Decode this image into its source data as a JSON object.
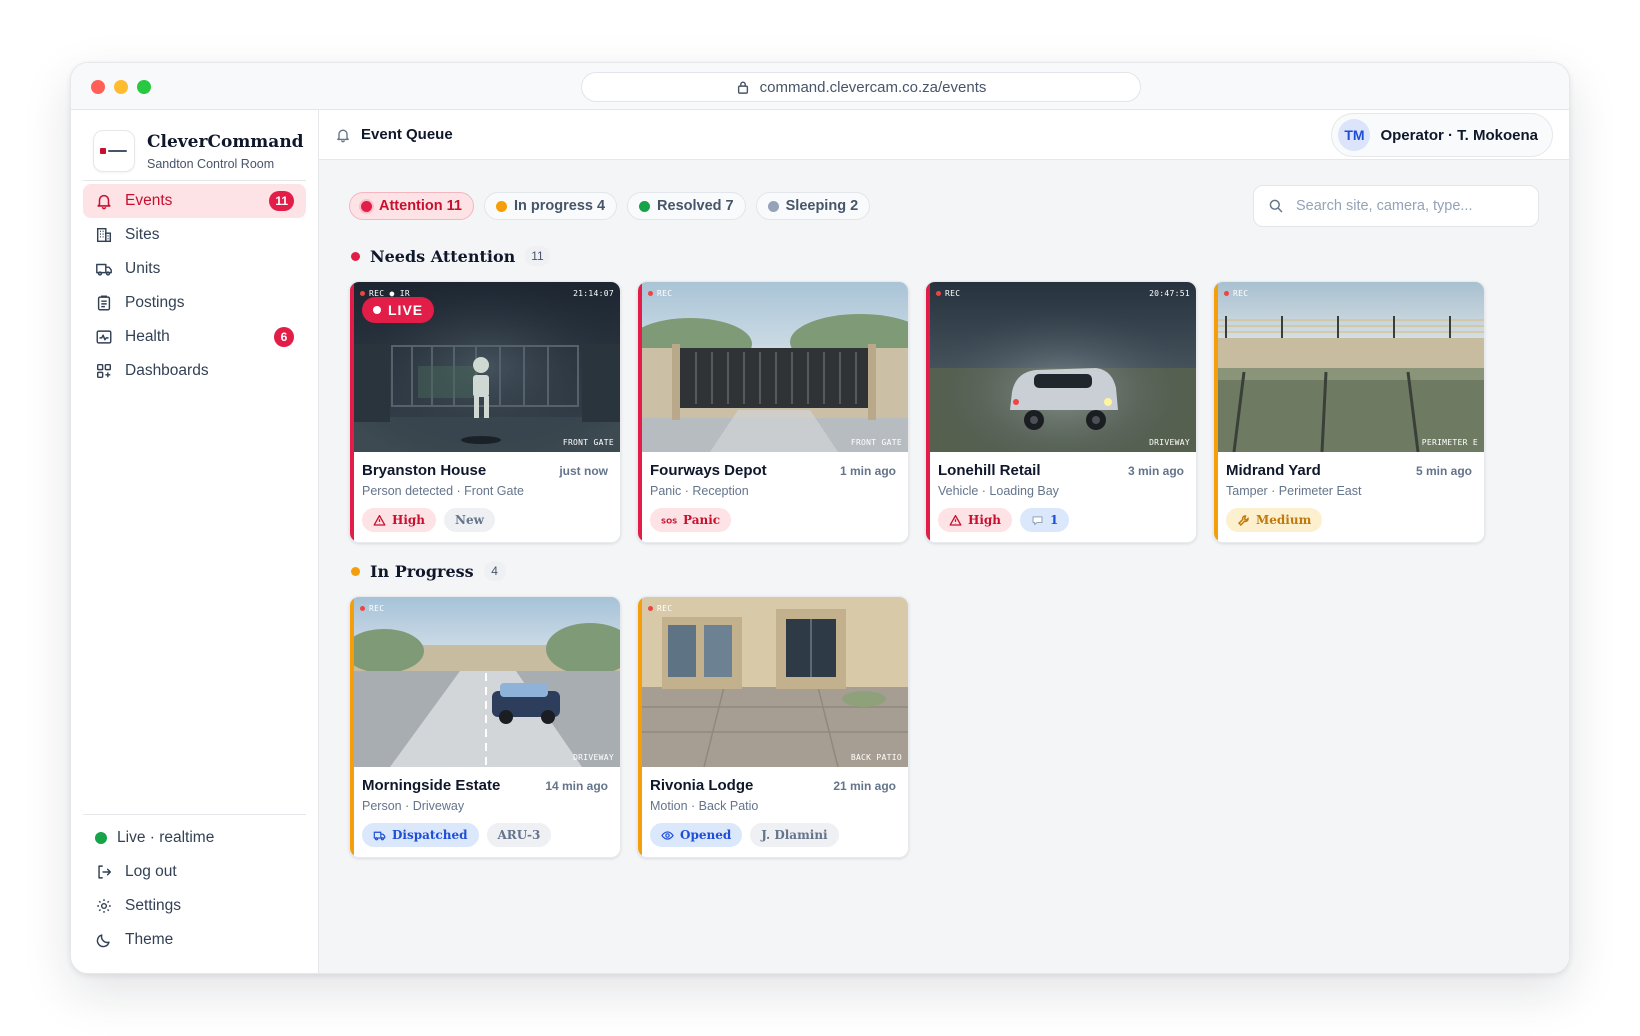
{
  "browser": {
    "url": "command.clevercam.co.za/events"
  },
  "brand": {
    "name": "CleverCommand",
    "subtitle": "Sandton Control Room"
  },
  "nav": [
    {
      "label": "Events",
      "icon": "bell-icon",
      "badge": "11",
      "active": true
    },
    {
      "label": "Sites",
      "icon": "building-icon",
      "badge": ""
    },
    {
      "label": "Units",
      "icon": "truck-icon",
      "badge": ""
    },
    {
      "label": "Postings",
      "icon": "clipboard-icon",
      "badge": ""
    },
    {
      "label": "Health",
      "icon": "activity-icon",
      "badge": "6"
    },
    {
      "label": "Dashboards",
      "icon": "grid-icon",
      "badge": ""
    }
  ],
  "sidebar_bottom": {
    "live_label": "Live · realtime",
    "logout_label": "Log out",
    "settings_label": "Settings",
    "theme_label": "Theme"
  },
  "topbar": {
    "title": "Event Queue",
    "operator_initials": "TM",
    "operator_label": "Operator · T. Mokoena"
  },
  "filters": [
    {
      "label": "Attention 11",
      "color": "#e11d48",
      "active": true
    },
    {
      "label": "In progress 4",
      "color": "#f59e0b",
      "active": false
    },
    {
      "label": "Resolved 7",
      "color": "#16a34a",
      "active": false
    },
    {
      "label": "Sleeping 2",
      "color": "#94a3b8",
      "active": false
    }
  ],
  "search": {
    "placeholder": "Search site, camera, type..."
  },
  "sections": [
    {
      "title": "Needs Attention",
      "count": "11",
      "color": "#e11d48"
    },
    {
      "title": "In Progress",
      "count": "4",
      "color": "#f59e0b"
    }
  ],
  "cards": [
    {
      "site": "Bryanston House",
      "time": "just now",
      "detail": "Person detected · Front Gate",
      "osd_left": "REC ● IR",
      "osd_time": "21:14:07",
      "camera": "FRONT GATE",
      "live": "LIVE",
      "accent": "#e11d48",
      "tags": [
        {
          "label": "High",
          "icon": "warning-icon",
          "style": "high"
        },
        {
          "label": "New",
          "icon": "",
          "style": "neutral"
        }
      ]
    },
    {
      "site": "Fourways Depot",
      "time": "1 min ago",
      "detail": "Panic · Reception",
      "osd_left": "REC",
      "osd_time": "",
      "camera": "FRONT GATE",
      "live": "",
      "accent": "#e11d48",
      "tags": [
        {
          "label": "Panic",
          "icon": "sos-icon",
          "style": "high"
        }
      ]
    },
    {
      "site": "Lonehill Retail",
      "time": "3 min ago",
      "detail": "Vehicle · Loading Bay",
      "osd_left": "REC",
      "osd_time": "20:47:51",
      "camera": "DRIVEWAY",
      "live": "",
      "accent": "#e11d48",
      "tags": [
        {
          "label": "High",
          "icon": "warning-icon",
          "style": "high"
        },
        {
          "label": "1",
          "icon": "comment-icon",
          "style": "blue"
        }
      ]
    },
    {
      "site": "Midrand Yard",
      "time": "5 min ago",
      "detail": "Tamper · Perimeter East",
      "osd_left": "REC",
      "osd_time": "",
      "camera": "PERIMETER E",
      "live": "",
      "accent": "#f59e0b",
      "tags": [
        {
          "label": "Medium",
          "icon": "wrench-icon",
          "style": "medium"
        }
      ]
    },
    {
      "site": "Morningside Estate",
      "time": "14 min ago",
      "detail": "Person · Driveway",
      "osd_left": "REC",
      "osd_time": "",
      "camera": "DRIVEWAY",
      "live": "",
      "accent": "#f59e0b",
      "tags": [
        {
          "label": "Dispatched",
          "icon": "truck-icon",
          "style": "blue"
        },
        {
          "label": "ARU-3",
          "icon": "",
          "style": "neutral"
        }
      ]
    },
    {
      "site": "Rivonia Lodge",
      "time": "21 min ago",
      "detail": "Motion · Back Patio",
      "osd_left": "REC",
      "osd_time": "",
      "camera": "BACK PATIO",
      "live": "",
      "accent": "#f59e0b",
      "tags": [
        {
          "label": "Opened",
          "icon": "eye-icon",
          "style": "blue"
        },
        {
          "label": "J. Dlamini",
          "icon": "",
          "style": "neutral"
        }
      ]
    }
  ]
}
